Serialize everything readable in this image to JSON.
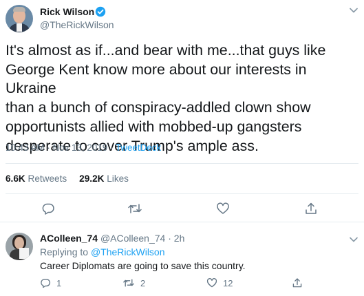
{
  "tweet": {
    "display_name": "Rick Wilson",
    "handle": "@TheRickWilson",
    "text": "It's almost as if...and bear with me...that guys like\nGeorge Kent know more about our interests in Ukraine\nthan a bunch of conspiracy-addled clown show\nopportunists allied with mobbed-up gangsters\ndesperate to cover Trump's ample ass.",
    "time": "10:43 AM",
    "separator": "·",
    "date": "Nov 13, 2019",
    "source": "TweetDeck",
    "retweets_count": "6.6K",
    "retweets_label": "Retweets",
    "likes_count": "29.2K",
    "likes_label": "Likes",
    "actions": [
      "reply-icon",
      "retweet-icon",
      "like-icon",
      "share-icon"
    ]
  },
  "reply": {
    "display_name": "AColleen_74",
    "handle": "@AColleen_74",
    "separator": "·",
    "age": "2h",
    "replying_prefix": "Replying to",
    "replying_to": "@TheRickWilson",
    "text": "Career Diplomats are going to save this country.",
    "reply_count": "1",
    "retweet_count": "2",
    "like_count": "12"
  },
  "colors": {
    "text": "#14171a",
    "secondary": "#657786",
    "accent": "#1da1f2",
    "divider": "#e6ecf0"
  }
}
